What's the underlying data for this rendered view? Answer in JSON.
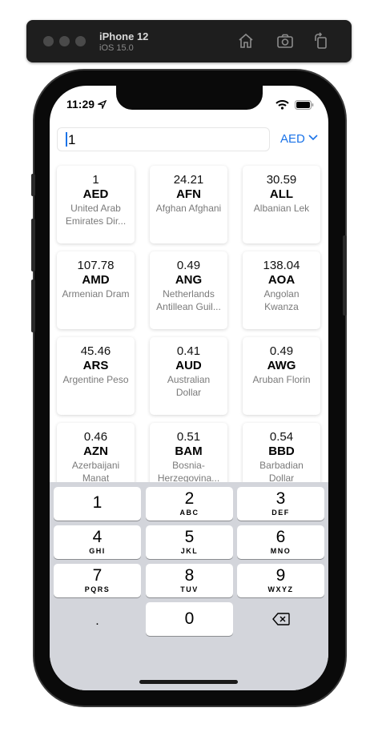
{
  "simulator": {
    "device_name": "iPhone 12",
    "os_version": "iOS 15.0"
  },
  "status_bar": {
    "time": "11:29"
  },
  "converter": {
    "amount_value": "1",
    "base_currency": "AED"
  },
  "currencies": [
    {
      "value": "1",
      "code": "AED",
      "name": "United Arab Emirates Dir..."
    },
    {
      "value": "24.21",
      "code": "AFN",
      "name": "Afghan Afghani"
    },
    {
      "value": "30.59",
      "code": "ALL",
      "name": "Albanian Lek"
    },
    {
      "value": "107.78",
      "code": "AMD",
      "name": "Armenian Dram"
    },
    {
      "value": "0.49",
      "code": "ANG",
      "name": "Netherlands Antillean Guil..."
    },
    {
      "value": "138.04",
      "code": "AOA",
      "name": "Angolan Kwanza"
    },
    {
      "value": "45.46",
      "code": "ARS",
      "name": "Argentine Peso"
    },
    {
      "value": "0.41",
      "code": "AUD",
      "name": "Australian Dollar"
    },
    {
      "value": "0.49",
      "code": "AWG",
      "name": "Aruban Florin"
    },
    {
      "value": "0.46",
      "code": "AZN",
      "name": "Azerbaijani Manat"
    },
    {
      "value": "0.51",
      "code": "BAM",
      "name": "Bosnia-Herzegovina..."
    },
    {
      "value": "0.54",
      "code": "BBD",
      "name": "Barbadian Dollar"
    }
  ],
  "keypad": [
    {
      "num": "1",
      "letters": ""
    },
    {
      "num": "2",
      "letters": "ABC"
    },
    {
      "num": "3",
      "letters": "DEF"
    },
    {
      "num": "4",
      "letters": "GHI"
    },
    {
      "num": "5",
      "letters": "JKL"
    },
    {
      "num": "6",
      "letters": "MNO"
    },
    {
      "num": "7",
      "letters": "PQRS"
    },
    {
      "num": "8",
      "letters": "TUV"
    },
    {
      "num": "9",
      "letters": "WXYZ"
    },
    {
      "num": ".",
      "letters": ""
    },
    {
      "num": "0",
      "letters": ""
    },
    {
      "num": "",
      "letters": "",
      "icon": "delete-backspace-icon"
    }
  ],
  "icons": {
    "home": "home-icon",
    "screenshot": "camera-icon",
    "rotate": "rotate-icon",
    "location": "location-arrow-icon",
    "wifi": "wifi-icon",
    "battery": "battery-icon",
    "dropdown": "chevron-down-icon",
    "delete": "delete-backspace-icon"
  },
  "colors": {
    "accent": "#1a73e8",
    "keypad_bg": "#d3d5db"
  }
}
